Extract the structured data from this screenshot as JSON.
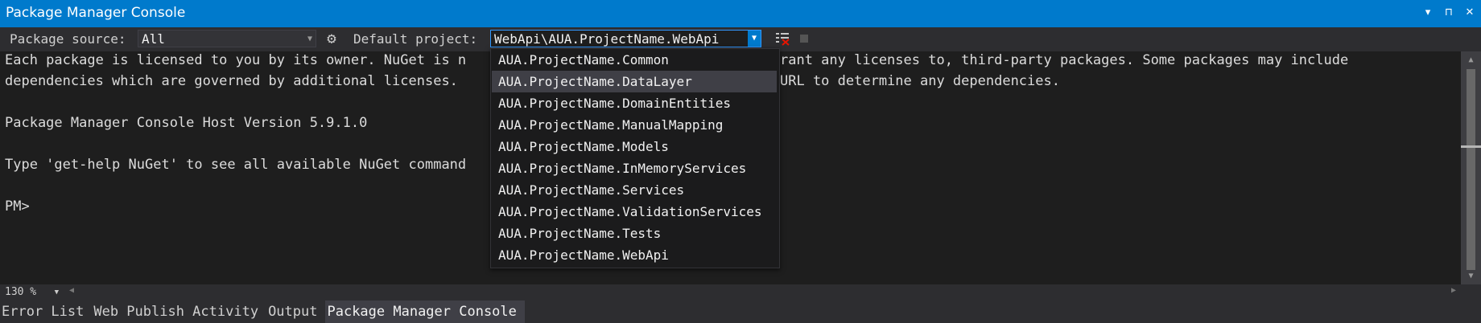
{
  "window": {
    "title": "Package Manager Console",
    "buttons": [
      "▾",
      "⊓",
      "✕"
    ]
  },
  "toolbar": {
    "package_source_label": "Package source:",
    "package_source_value": "All",
    "default_project_label": "Default project:",
    "default_project_value": "WebApi\\AUA.ProjectName.WebApi",
    "icons": [
      "gear-icon",
      "clear-console-icon",
      "stop-icon"
    ]
  },
  "console": {
    "lines": [
      "Each package is licensed to you by its owner. NuGet is n",
      "rant any licenses to, third-party packages. Some packages may include",
      "dependencies which are governed by additional licenses.",
      "URL to determine any dependencies.",
      "Package Manager Console Host Version 5.9.1.0",
      "Type 'get-help NuGet' to see all available NuGet command",
      "PM>"
    ]
  },
  "dropdown": {
    "items": [
      "AUA.ProjectName.Common",
      "AUA.ProjectName.DataLayer",
      "AUA.ProjectName.DomainEntities",
      "AUA.ProjectName.ManualMapping",
      "AUA.ProjectName.Models",
      "AUA.ProjectName.InMemoryServices",
      "AUA.ProjectName.Services",
      "AUA.ProjectName.ValidationServices",
      "AUA.ProjectName.Tests",
      "AUA.ProjectName.WebApi"
    ],
    "selected_index": 1
  },
  "status": {
    "zoom": "130 %"
  },
  "tabs": [
    "Error List",
    "Web Publish Activity",
    "Output",
    "Package Manager Console"
  ],
  "active_tab": 3,
  "colors": {
    "accent": "#007acc",
    "background": "#1e1e1e",
    "chrome": "#2d2d30"
  }
}
